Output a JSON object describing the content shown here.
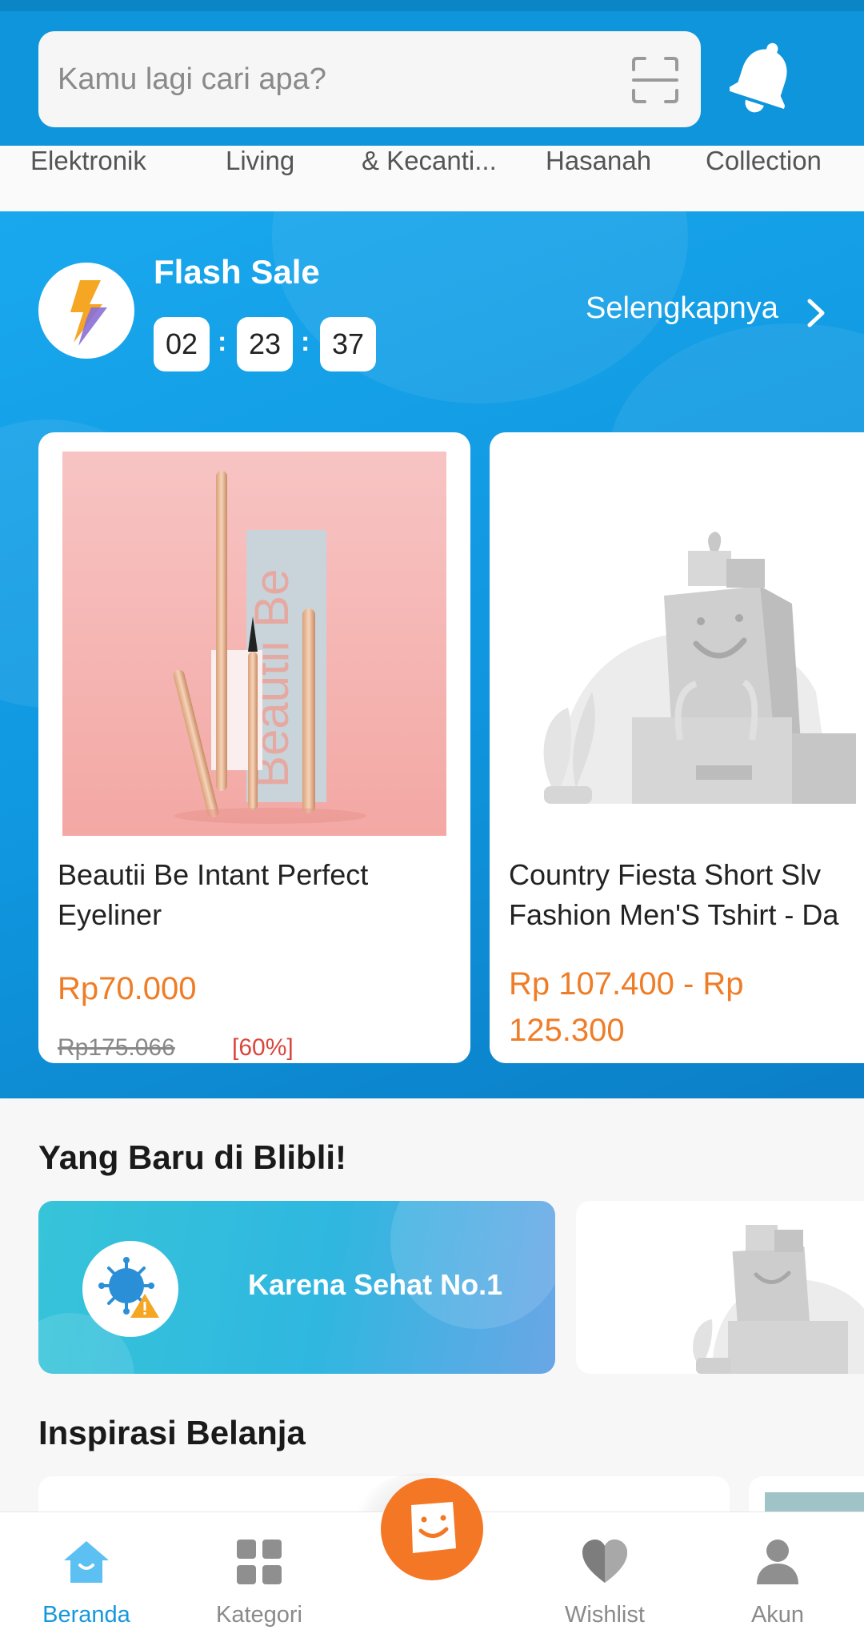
{
  "header": {
    "search_placeholder": "Kamu lagi cari apa?",
    "icons": {
      "scan": "scan-icon",
      "notification": "bell-icon"
    }
  },
  "categories": [
    "Elektronik",
    "Living",
    "& Kecanti...",
    "Hasanah",
    "Collection"
  ],
  "flash_sale": {
    "title": "Flash Sale",
    "timer": {
      "hours": "02",
      "minutes": "23",
      "seconds": "37"
    },
    "separator": ":",
    "see_more": "Selengkapnya",
    "products": [
      {
        "name": "Beautii Be Intant Perfect\nEyeliner",
        "price": "Rp70.000",
        "original_price": "Rp175.066",
        "discount": "[60%]",
        "image_text": "Beautii Be"
      },
      {
        "name": "Country Fiesta Short Slv\nFashion Men'S Tshirt - Da",
        "price": "Rp 107.400 - Rp\n125.300"
      }
    ]
  },
  "new_section": {
    "title": "Yang Baru di Blibli!",
    "banner_text": "Karena Sehat No.1"
  },
  "inspiration": {
    "title": "Inspirasi Belanja"
  },
  "bottom_nav": {
    "items": [
      {
        "label": "Beranda",
        "icon": "home-icon",
        "active": true
      },
      {
        "label": "Kategori",
        "icon": "grid-icon",
        "active": false
      },
      {
        "label": "Wishlist",
        "icon": "heart-icon",
        "active": false
      },
      {
        "label": "Akun",
        "icon": "user-icon",
        "active": false
      }
    ]
  },
  "colors": {
    "brand_blue": "#0e95dc",
    "price_orange": "#ef7d27",
    "discount_red": "#d9463b",
    "fab_orange": "#f47725"
  }
}
